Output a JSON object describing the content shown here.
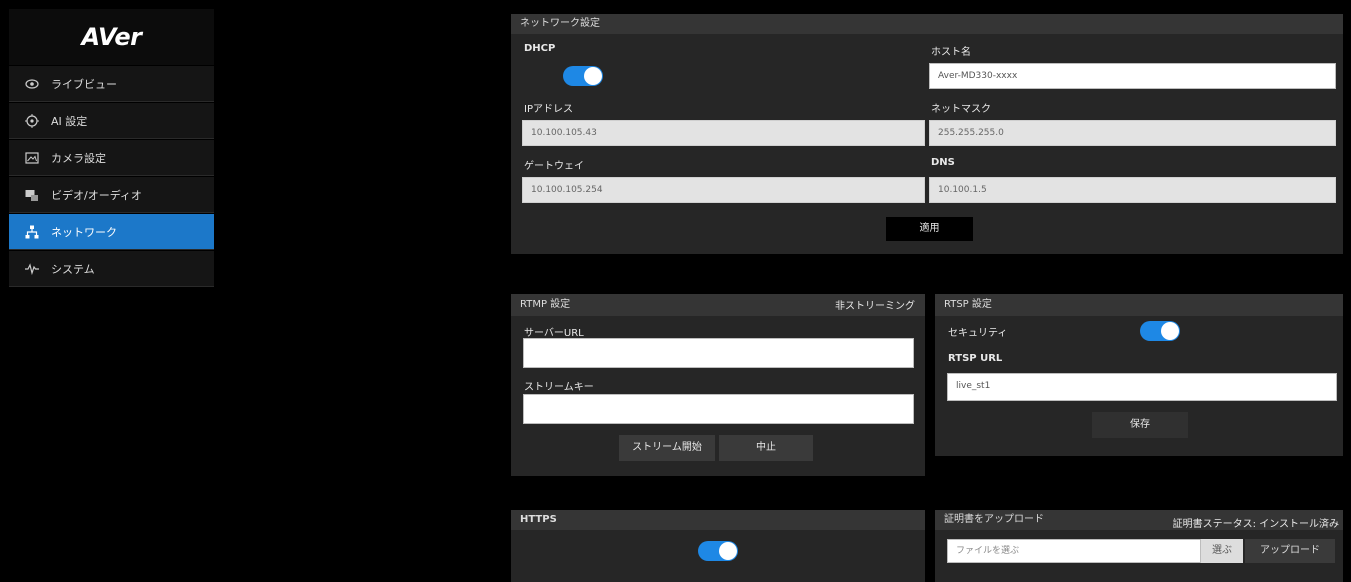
{
  "sidebar": {
    "logo": "AVer",
    "items": [
      {
        "label": "ライブビュー",
        "icon": "eye-icon"
      },
      {
        "label": "AI 設定",
        "icon": "ai-target-icon"
      },
      {
        "label": "カメラ設定",
        "icon": "camera-settings-icon"
      },
      {
        "label": "ビデオ/オーディオ",
        "icon": "video-audio-icon"
      },
      {
        "label": "ネットワーク",
        "icon": "network-icon"
      },
      {
        "label": "システム",
        "icon": "system-pulse-icon"
      }
    ],
    "active_index": 4,
    "accent_color": "#1c78c9"
  },
  "network": {
    "title": "ネットワーク設定",
    "dhcp_label": "DHCP",
    "dhcp_on": true,
    "hostname_label": "ホスト名",
    "hostname_value": "Aver-MD330-xxxx",
    "ip_label": "IPアドレス",
    "ip_value": "10.100.105.43",
    "netmask_label": "ネットマスク",
    "netmask_value": "255.255.255.0",
    "gateway_label": "ゲートウェイ",
    "gateway_value": "10.100.105.254",
    "dns_label": "DNS",
    "dns_value": "10.100.1.5",
    "apply_label": "適用"
  },
  "rtmp": {
    "title": "RTMP 設定",
    "status": "非ストリーミング",
    "server_url_label": "サーバーURL",
    "server_url_value": "",
    "stream_key_label": "ストリームキー",
    "stream_key_value": "",
    "start_label": "ストリーム開始",
    "stop_label": "中止"
  },
  "rtsp": {
    "title": "RTSP 設定",
    "security_label": "セキュリティ",
    "security_on": true,
    "url_label": "RTSP URL",
    "url_value": "live_st1",
    "save_label": "保存"
  },
  "https": {
    "title": "HTTPS",
    "enabled": true
  },
  "certificate": {
    "title": "証明書をアップロード",
    "status": "証明書ステータス: インストール済み",
    "file_placeholder": "ファイルを選ぶ",
    "browse_label": "選ぶ",
    "upload_label": "アップロード"
  },
  "colors": {
    "toggle_on": "#1e88e5",
    "panel_bg": "#262626",
    "panel_header": "#353535"
  }
}
